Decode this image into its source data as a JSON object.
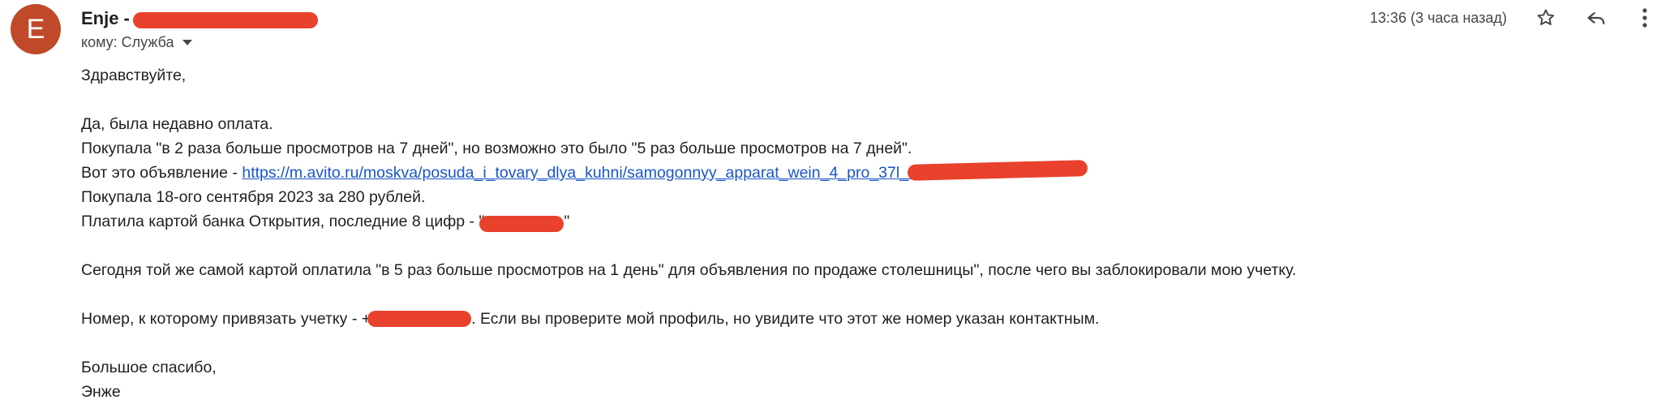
{
  "sender": {
    "avatar_letter": "E",
    "avatar_color": "#c0492a",
    "name": "Enje",
    "dash": "-"
  },
  "recipient": {
    "label": "кому: Служба"
  },
  "time": "13:36 (3 часа назад)",
  "icons": {
    "star": "star-icon",
    "reply": "reply-icon",
    "more": "more-vert-icon",
    "dropdown": "caret-down-icon"
  },
  "message": {
    "greeting": "Здравствуйте,",
    "line1": "Да, была недавно оплата.",
    "line2": "Покупала \"в 2 раза больше просмотров на 7 дней\", но возможно это было \"5 раз больше просмотров на 7 дней\".",
    "line3_prefix": "Вот это объявление - ",
    "line3_link": "https://m.avito.ru/moskva/posuda_i_tovary_dlya_kuhni/samogonnyy_apparat_wein_4_pro_37l_2",
    "line4": "Покупала 18-ого сентября 2023 за 280 рублей.",
    "line5_prefix": "Платила картой банка Открытия, последние 8 цифр - \"",
    "line5_suffix": "\"",
    "line6": "Сегодня той же самой картой оплатила  \"в 5 раз больше просмотров на 1 день\" для объявления по продаже столешницы\", после чего вы заблокировали мою учетку.",
    "line7_prefix": "Номер, к которому привязать учетку - +",
    "line7_suffix": ".  Если вы проверите мой профиль, но увидите что этот же номер указан контактным.",
    "closing": "Большое спасибо,",
    "signature": "Энже"
  },
  "colors": {
    "link": "#1a55c7",
    "redaction": "#e8412c"
  }
}
